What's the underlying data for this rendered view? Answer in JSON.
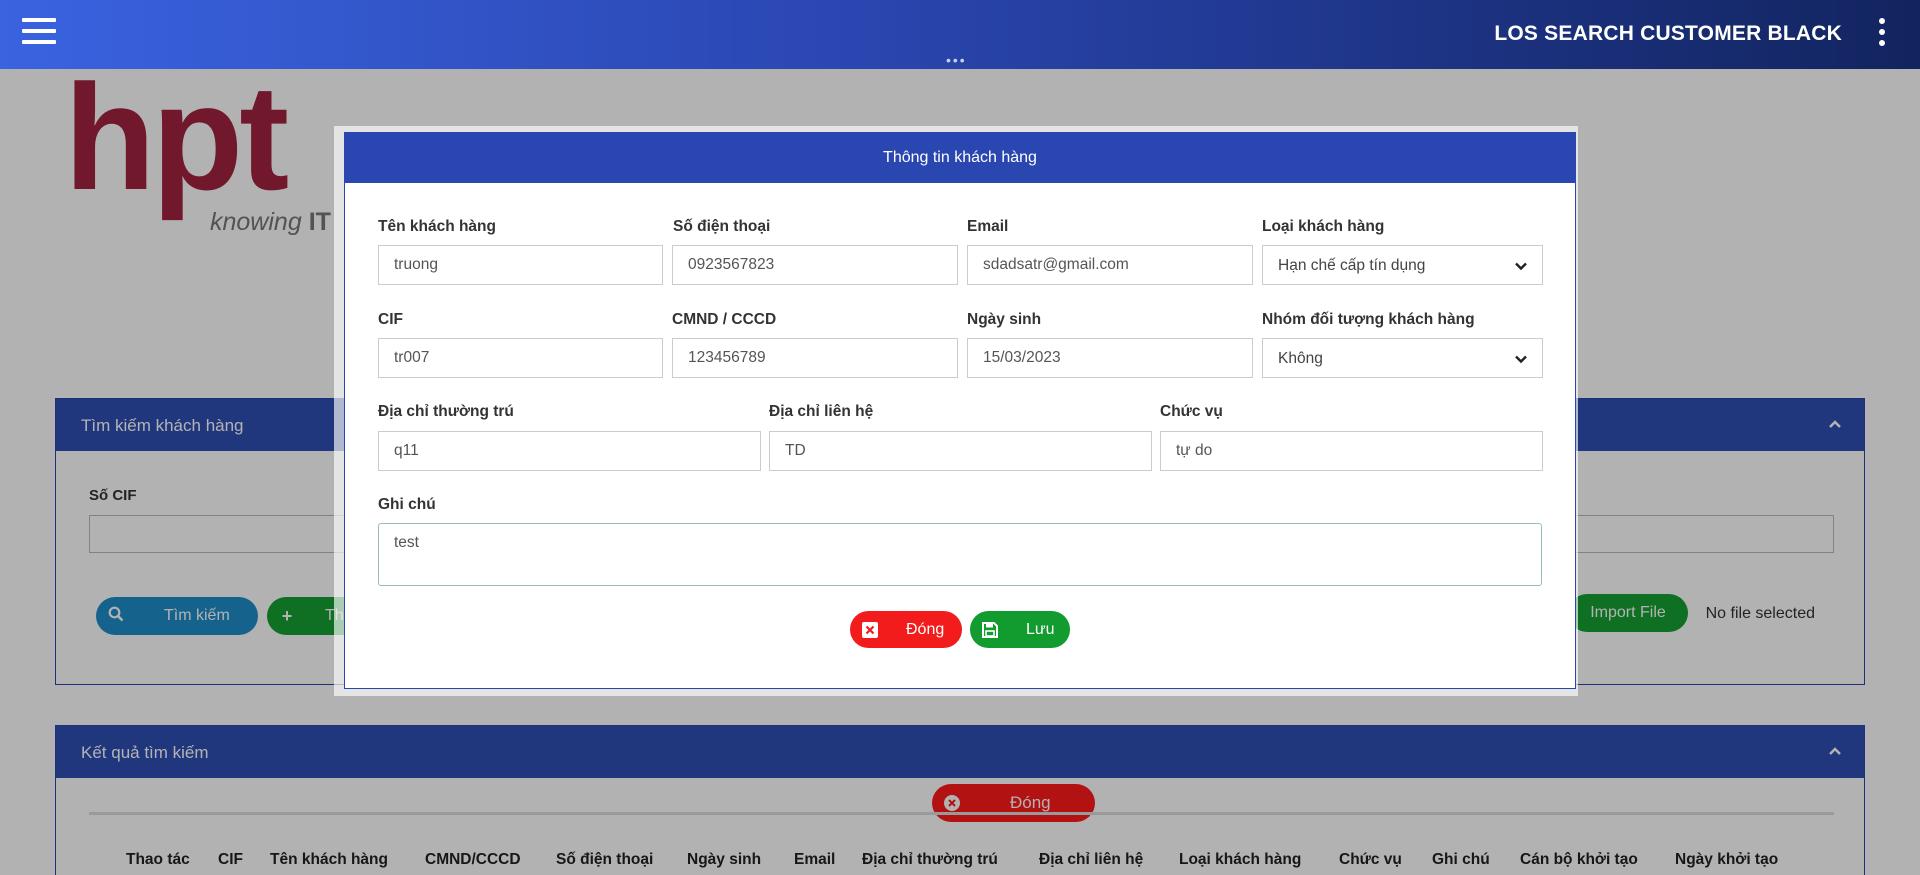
{
  "header": {
    "title": "LOS SEARCH CUSTOMER BLACK"
  },
  "logo": {
    "brand": "hpt",
    "tagline_main": "knowing",
    "tagline_bold": "IT"
  },
  "search_panel": {
    "title": "Tìm kiếm khách hàng",
    "cif_label": "Số CIF",
    "search_button": "Tìm kiếm",
    "add_button": "Th",
    "import_button": "Import File",
    "file_status": "No file selected"
  },
  "result_panel": {
    "title": "Kết quả tìm kiếm",
    "close_button": "Đóng",
    "columns": [
      "Thao tác",
      "CIF",
      "Tên khách hàng",
      "CMND/CCCD",
      "Số điện thoại",
      "Ngày sinh",
      "Email",
      "Địa chỉ thường trú",
      "Địa chỉ liên hệ",
      "Loại khách hàng",
      "Chức vụ",
      "Ghi chú",
      "Cán bộ khởi tạo",
      "Ngày khởi tạo"
    ]
  },
  "modal": {
    "title": "Thông tin khách hàng",
    "fields": {
      "customer_name": {
        "label": "Tên khách hàng",
        "value": "truong"
      },
      "phone": {
        "label": "Số điện thoại",
        "value": "0923567823"
      },
      "email": {
        "label": "Email",
        "value": "sdadsatr@gmail.com"
      },
      "customer_type": {
        "label": "Loại khách hàng",
        "value": "Hạn chế cấp tín dụng"
      },
      "cif": {
        "label": "CIF",
        "value": "tr007"
      },
      "id_number": {
        "label": "CMND / CCCD",
        "value": "123456789"
      },
      "birth_date": {
        "label": "Ngày sinh",
        "value": "15/03/2023"
      },
      "customer_group": {
        "label": "Nhóm đối tượng khách hàng",
        "value": "Không"
      },
      "permanent_address": {
        "label": "Địa chỉ thường trú",
        "value": "q11"
      },
      "contact_address": {
        "label": "Địa chỉ liên hệ",
        "value": "TD"
      },
      "position": {
        "label": "Chức vụ",
        "value": "tự do"
      },
      "note": {
        "label": "Ghi chú",
        "value": "test"
      }
    },
    "close_button": "Đóng",
    "save_button": "Lưu"
  },
  "colors": {
    "primary": "#2a46b0",
    "danger": "#f21c1c",
    "success": "#129b2f",
    "info": "#1f8fc9",
    "logo": "#a32340"
  }
}
